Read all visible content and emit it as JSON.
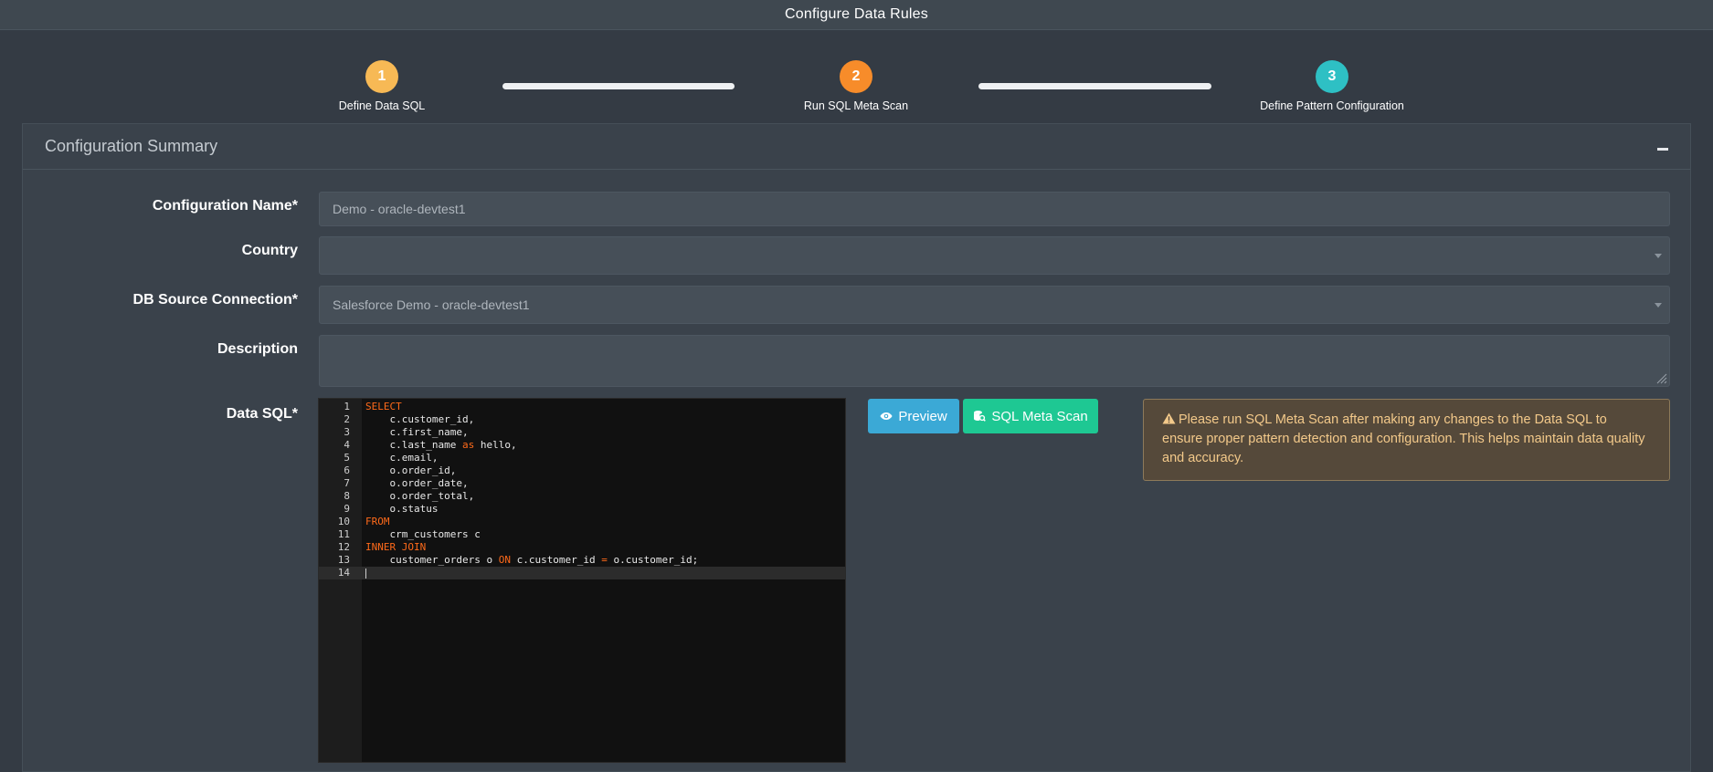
{
  "header": {
    "title": "Configure Data Rules"
  },
  "stepper": {
    "steps": [
      {
        "number": "1",
        "label": "Define Data SQL",
        "color": "#f7b955"
      },
      {
        "number": "2",
        "label": "Run SQL Meta Scan",
        "color": "#f78c2a"
      },
      {
        "number": "3",
        "label": "Define Pattern Configuration",
        "color": "#2ec0c4"
      }
    ]
  },
  "card": {
    "title": "Configuration Summary"
  },
  "form": {
    "config_name": {
      "label": "Configuration Name*",
      "value": "Demo - oracle-devtest1"
    },
    "country": {
      "label": "Country",
      "value": ""
    },
    "db_source": {
      "label": "DB Source Connection*",
      "value": "Salesforce Demo - oracle-devtest1"
    },
    "description": {
      "label": "Description",
      "value": ""
    },
    "data_sql": {
      "label": "Data SQL*"
    }
  },
  "editor": {
    "lines": [
      {
        "n": "1",
        "parts": [
          {
            "t": "SELECT",
            "kw": true
          }
        ]
      },
      {
        "n": "2",
        "parts": [
          {
            "t": "    c.customer_id,"
          }
        ]
      },
      {
        "n": "3",
        "parts": [
          {
            "t": "    c.first_name,"
          }
        ]
      },
      {
        "n": "4",
        "parts": [
          {
            "t": "    c.last_name "
          },
          {
            "t": "as",
            "kw": true
          },
          {
            "t": " hello,"
          }
        ]
      },
      {
        "n": "5",
        "parts": [
          {
            "t": "    c.email,"
          }
        ]
      },
      {
        "n": "6",
        "parts": [
          {
            "t": "    o.order_id,"
          }
        ]
      },
      {
        "n": "7",
        "parts": [
          {
            "t": "    o.order_date,"
          }
        ]
      },
      {
        "n": "8",
        "parts": [
          {
            "t": "    o.order_total,"
          }
        ]
      },
      {
        "n": "9",
        "parts": [
          {
            "t": "    o.status"
          }
        ]
      },
      {
        "n": "10",
        "parts": [
          {
            "t": "FROM",
            "kw": true
          }
        ]
      },
      {
        "n": "11",
        "parts": [
          {
            "t": "    crm_customers c"
          }
        ]
      },
      {
        "n": "12",
        "parts": [
          {
            "t": "INNER JOIN",
            "kw": true
          }
        ]
      },
      {
        "n": "13",
        "parts": [
          {
            "t": "    customer_orders o "
          },
          {
            "t": "ON",
            "kw": true
          },
          {
            "t": " c.customer_id "
          },
          {
            "t": "=",
            "kw": true
          },
          {
            "t": " o.customer_id;"
          }
        ]
      },
      {
        "n": "14",
        "parts": []
      }
    ]
  },
  "buttons": {
    "preview": "Preview",
    "meta_scan": "SQL Meta Scan"
  },
  "alert": {
    "text": "Please run SQL Meta Scan after making any changes to the Data SQL to ensure proper pattern detection and configuration. This helps maintain data quality and accuracy."
  },
  "icons": {
    "preview": "eye-icon",
    "meta_scan": "database-search-icon",
    "alert": "warning-triangle-icon",
    "collapse": "minus-icon"
  }
}
